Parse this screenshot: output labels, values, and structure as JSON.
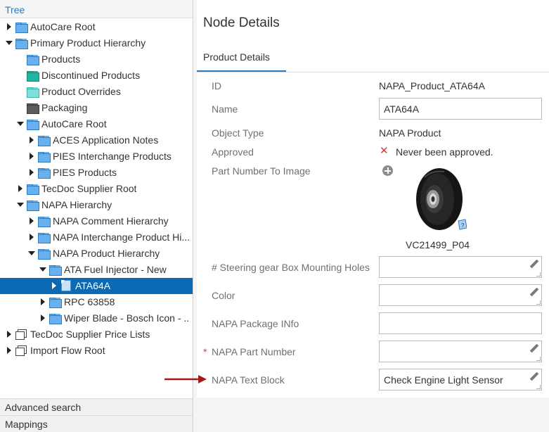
{
  "tree_panel": {
    "header": "Tree",
    "items": [
      {
        "label": "AutoCare Root",
        "caret": "right",
        "icon": "folder-blue"
      },
      {
        "label": "Primary Product Hierarchy",
        "caret": "down",
        "icon": "folder-blue"
      },
      {
        "label": "Products",
        "caret": "none",
        "icon": "folder-blue"
      },
      {
        "label": "Discontinued Products",
        "caret": "none",
        "icon": "folder-teal"
      },
      {
        "label": "Product Overrides",
        "caret": "none",
        "icon": "folder-cyan"
      },
      {
        "label": "Packaging",
        "caret": "none",
        "icon": "folder-dark"
      },
      {
        "label": "AutoCare Root",
        "caret": "down",
        "icon": "folder-blue"
      },
      {
        "label": "ACES Application Notes",
        "caret": "right",
        "icon": "folder-blue"
      },
      {
        "label": "PIES Interchange Products",
        "caret": "right",
        "icon": "folder-blue"
      },
      {
        "label": "PIES Products",
        "caret": "right",
        "icon": "folder-blue"
      },
      {
        "label": "TecDoc Supplier Root",
        "caret": "right",
        "icon": "folder-blue"
      },
      {
        "label": "NAPA Hierarchy",
        "caret": "down",
        "icon": "folder-blue"
      },
      {
        "label": "NAPA Comment Hierarchy",
        "caret": "right",
        "icon": "folder-blue"
      },
      {
        "label": "NAPA Interchange Product Hi...",
        "caret": "right",
        "icon": "folder-blue"
      },
      {
        "label": "NAPA Product Hierarchy",
        "caret": "down",
        "icon": "folder-blue"
      },
      {
        "label": "ATA Fuel Injector - New",
        "caret": "down",
        "icon": "folder-blue"
      },
      {
        "label": "ATA64A",
        "caret": "right",
        "icon": "product-doc",
        "selected": true
      },
      {
        "label": "RPC 63858",
        "caret": "right",
        "icon": "folder-blue"
      },
      {
        "label": "Wiper Blade - Bosch Icon - ...",
        "caret": "right",
        "icon": "folder-blue"
      },
      {
        "label": "TecDoc Supplier Price Lists",
        "caret": "right",
        "icon": "multi-doc"
      },
      {
        "label": "Import Flow Root",
        "caret": "right",
        "icon": "multi-doc"
      }
    ],
    "footer": {
      "advanced_search": "Advanced search",
      "mappings": "Mappings"
    }
  },
  "details": {
    "title": "Node Details",
    "tab": "Product Details",
    "fields": {
      "id": {
        "label": "ID",
        "value": "NAPA_Product_ATA64A"
      },
      "name": {
        "label": "Name",
        "value": "ATA64A"
      },
      "object_type": {
        "label": "Object Type",
        "value": "NAPA Product"
      },
      "approved": {
        "label": "Approved",
        "value": "Never been approved."
      },
      "part_image": {
        "label": "Part Number To Image",
        "caption": "VC21499_P04"
      },
      "steering": {
        "label": "# Steering gear Box Mounting Holes",
        "value": ""
      },
      "color": {
        "label": "Color",
        "value": ""
      },
      "package_info": {
        "label": "NAPA Package INfo",
        "value": ""
      },
      "part_number": {
        "label": "NAPA Part Number",
        "value": "",
        "required_mark": "*"
      },
      "text_block": {
        "label": "NAPA Text Block",
        "value": "Check Engine Light Sensor"
      }
    }
  },
  "colors": {
    "selection": "#0c6ab4",
    "accent": "#2b7bbd",
    "required": "#d43d3d",
    "annotation_arrow": "#a01c1c"
  }
}
